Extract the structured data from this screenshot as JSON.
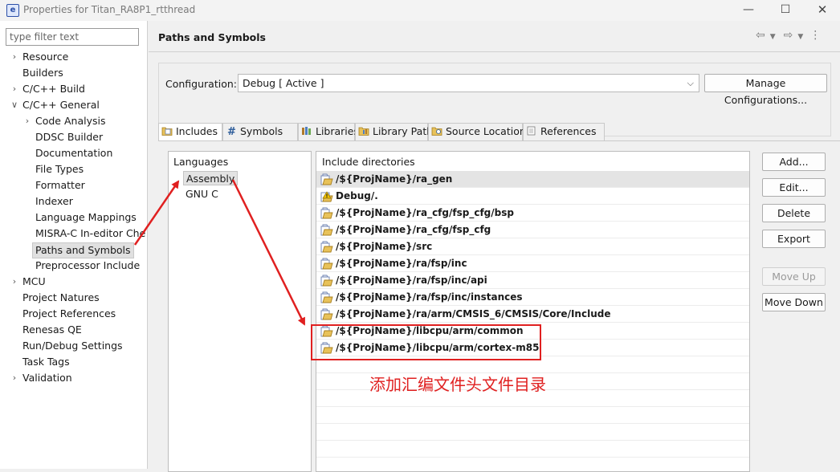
{
  "window": {
    "title": "Properties for Titan_RA8P1_rtthread",
    "app_icon": "e"
  },
  "filter": {
    "placeholder": "type filter text"
  },
  "tree": [
    {
      "label": "Resource",
      "depth": 0,
      "toggle": "collapsed"
    },
    {
      "label": "Builders",
      "depth": 0,
      "toggle": "none"
    },
    {
      "label": "C/C++ Build",
      "depth": 0,
      "toggle": "collapsed"
    },
    {
      "label": "C/C++ General",
      "depth": 0,
      "toggle": "expanded"
    },
    {
      "label": "Code Analysis",
      "depth": 1,
      "toggle": "collapsed"
    },
    {
      "label": "DDSC Builder",
      "depth": 1,
      "toggle": "none"
    },
    {
      "label": "Documentation",
      "depth": 1,
      "toggle": "none"
    },
    {
      "label": "File Types",
      "depth": 1,
      "toggle": "none"
    },
    {
      "label": "Formatter",
      "depth": 1,
      "toggle": "none"
    },
    {
      "label": "Indexer",
      "depth": 1,
      "toggle": "none"
    },
    {
      "label": "Language Mappings",
      "depth": 1,
      "toggle": "none"
    },
    {
      "label": "MISRA-C In-editor Che",
      "depth": 1,
      "toggle": "none"
    },
    {
      "label": "Paths and Symbols",
      "depth": 1,
      "toggle": "none",
      "selected": true
    },
    {
      "label": "Preprocessor Include",
      "depth": 1,
      "toggle": "none"
    },
    {
      "label": "MCU",
      "depth": 0,
      "toggle": "collapsed"
    },
    {
      "label": "Project Natures",
      "depth": 0,
      "toggle": "none"
    },
    {
      "label": "Project References",
      "depth": 0,
      "toggle": "none"
    },
    {
      "label": "Renesas QE",
      "depth": 0,
      "toggle": "none"
    },
    {
      "label": "Run/Debug Settings",
      "depth": 0,
      "toggle": "none"
    },
    {
      "label": "Task Tags",
      "depth": 0,
      "toggle": "none"
    },
    {
      "label": "Validation",
      "depth": 0,
      "toggle": "collapsed"
    }
  ],
  "page": {
    "title": "Paths and Symbols"
  },
  "configuration": {
    "label": "Configuration:",
    "value": "Debug   [ Active ]",
    "manage_label": "Manage Configurations..."
  },
  "tabs": [
    {
      "label": "Includes",
      "icon": "includes-icon",
      "active": true
    },
    {
      "label": "Symbols",
      "icon": "hash-icon"
    },
    {
      "label": "Libraries",
      "icon": "libraries-icon"
    },
    {
      "label": "Library Paths",
      "icon": "library-paths-icon"
    },
    {
      "label": "Source Location",
      "icon": "source-location-icon"
    },
    {
      "label": "References",
      "icon": "references-icon"
    }
  ],
  "languages": {
    "header": "Languages",
    "items": [
      {
        "label": "Assembly",
        "selected": true
      },
      {
        "label": "GNU C"
      }
    ]
  },
  "includes": {
    "header": "Include directories",
    "items": [
      {
        "path": "/${ProjName}/ra_gen",
        "highlighted": true
      },
      {
        "path": "Debug/.",
        "icon": "warning"
      },
      {
        "path": "/${ProjName}/ra_cfg/fsp_cfg/bsp"
      },
      {
        "path": "/${ProjName}/ra_cfg/fsp_cfg"
      },
      {
        "path": "/${ProjName}/src"
      },
      {
        "path": "/${ProjName}/ra/fsp/inc"
      },
      {
        "path": "/${ProjName}/ra/fsp/inc/api"
      },
      {
        "path": "/${ProjName}/ra/fsp/inc/instances"
      },
      {
        "path": "/${ProjName}/ra/arm/CMSIS_6/CMSIS/Core/Include"
      },
      {
        "path": "/${ProjName}/libcpu/arm/common"
      },
      {
        "path": "/${ProjName}/libcpu/arm/cortex-m85"
      }
    ]
  },
  "buttons": {
    "add": "Add...",
    "edit": "Edit...",
    "delete": "Delete",
    "export": "Export",
    "move_up": "Move Up",
    "move_down": "Move Down"
  },
  "annotation": {
    "text": "添加汇编文件头文件目录",
    "color": "#e02020"
  },
  "colors": {
    "annotation": "#e02020",
    "selection": "#e0e0e0"
  }
}
